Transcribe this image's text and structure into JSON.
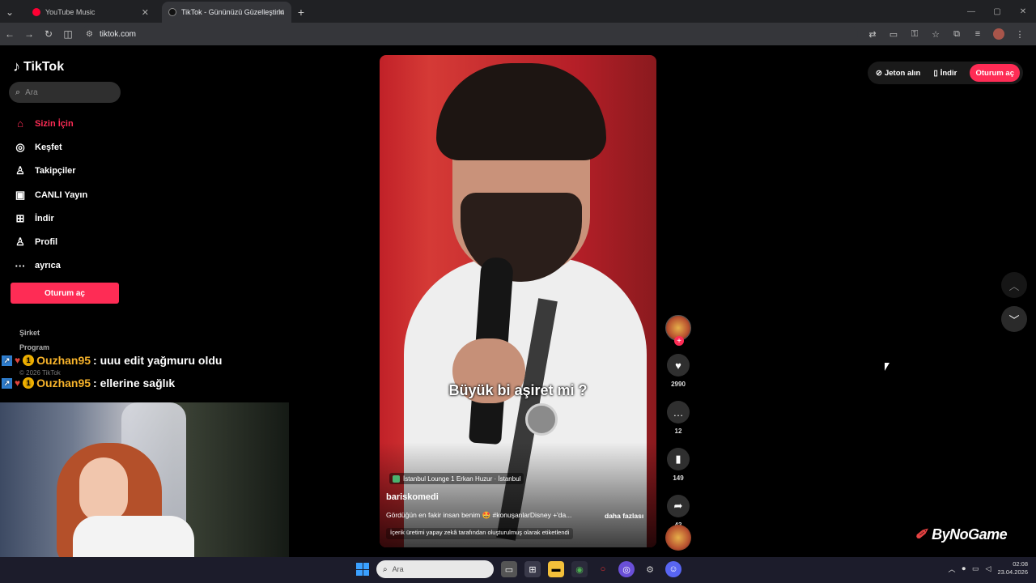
{
  "browser": {
    "tabs": [
      {
        "title": "YouTube Music",
        "color": "#ff0033"
      },
      {
        "title": "TikTok - Gününüzü Güzelleştirin",
        "color": "#111111"
      }
    ],
    "new_tab_icon": "plus-icon",
    "url": "tiktok.com"
  },
  "sidebar": {
    "logo": "TikTok",
    "search_placeholder": "Ara",
    "nav": [
      {
        "label": "Sizin İçin",
        "icon": "home-icon",
        "glyph": "⌂",
        "active": true
      },
      {
        "label": "Keşfet",
        "icon": "compass-icon",
        "glyph": "◎",
        "active": false
      },
      {
        "label": "Takipçiler",
        "icon": "user-follow-icon",
        "glyph": "♙",
        "active": false
      },
      {
        "label": "CANLI Yayın",
        "icon": "live-tv-icon",
        "glyph": "▣",
        "active": false
      },
      {
        "label": "İndir",
        "icon": "download-icon",
        "glyph": "⊞",
        "active": false
      },
      {
        "label": "Profil",
        "icon": "profile-icon",
        "glyph": "♙",
        "active": false
      },
      {
        "label": "ayrıca",
        "icon": "more-icon",
        "glyph": "···",
        "active": false
      }
    ],
    "login_button": "Oturum aç",
    "footer_links": [
      "Şirket",
      "Program"
    ],
    "copyright": "© 2026 TikTok"
  },
  "chat": [
    {
      "user": "Ouzhan95",
      "message": ": uuu edit yağmuru oldu"
    },
    {
      "user": "Ouzhan95",
      "message": ": ellerine sağlık"
    }
  ],
  "video": {
    "subtitle": "Büyük bi aşiret mi ?",
    "location": "İstanbul Lounge 1 Erkan Huzur · İstanbul",
    "author": "bariskomedi",
    "description": "Gördüğün en fakir insan benim 🤩 #konuşanlarDisney +'da...",
    "more": "daha fazlası",
    "ai_label": "İçerik üretimi yapay zekâ tarafından oluşturulmuş olarak etiketlendi"
  },
  "actions": {
    "likes": "2990",
    "comments": "12",
    "saves": "149",
    "shares": "43"
  },
  "top_right": {
    "coins": "Jeton alın",
    "download": "İndir",
    "login": "Oturum aç"
  },
  "watermark": "ByNoGame",
  "taskbar": {
    "search_placeholder": "Ara",
    "time": "02:08",
    "date": "23.04.2026"
  },
  "colors": {
    "accent": "#fe2c55",
    "background": "#000000"
  }
}
